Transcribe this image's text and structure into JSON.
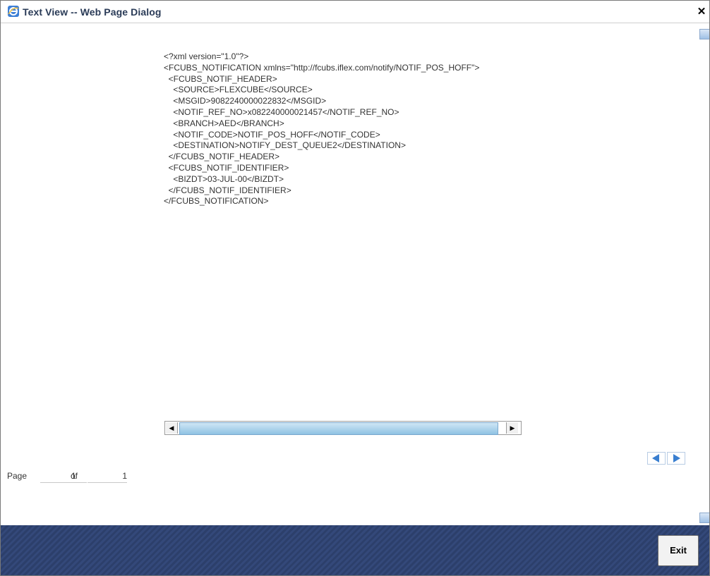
{
  "window": {
    "title": "Text View -- Web Page Dialog",
    "close_glyph": "✕"
  },
  "xml_lines": [
    "<?xml version=\"1.0\"?>",
    "<FCUBS_NOTIFICATION xmlns=\"http://fcubs.iflex.com/notify/NOTIF_POS_HOFF\">",
    "  <FCUBS_NOTIF_HEADER>",
    "    <SOURCE>FLEXCUBE</SOURCE>",
    "    <MSGID>9082240000022832</MSGID>",
    "    <NOTIF_REF_NO>x082240000021457</NOTIF_REF_NO>",
    "    <BRANCH>AED</BRANCH>",
    "    <NOTIF_CODE>NOTIF_POS_HOFF</NOTIF_CODE>",
    "    <DESTINATION>NOTIFY_DEST_QUEUE2</DESTINATION>",
    "  </FCUBS_NOTIF_HEADER>",
    "  <FCUBS_NOTIF_IDENTIFIER>",
    "    <BIZDT>03-JUL-00</BIZDT>",
    "  </FCUBS_NOTIF_IDENTIFIER>",
    "</FCUBS_NOTIFICATION>"
  ],
  "pager": {
    "page_label": "Page",
    "current": "1",
    "of_label": "of",
    "total": "1"
  },
  "footer": {
    "exit_label": "Exit"
  },
  "icons": {
    "window_icon": "ie-icon",
    "close": "close-icon",
    "prev": "arrow-left-icon",
    "next": "arrow-right-icon"
  },
  "colors": {
    "footer": "#2c3f6b",
    "title_text": "#2a3b57",
    "scrollbar_thumb": "#9fc0e6"
  }
}
